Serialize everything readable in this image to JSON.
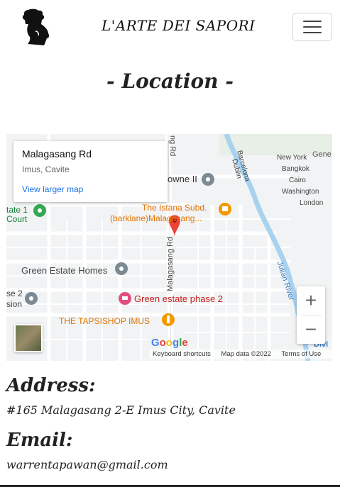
{
  "navbar": {
    "brand": "L'ARTE DEI SAPORI",
    "logo_icon": "chef-head-logo-icon",
    "menu_icon": "hamburger-menu-icon"
  },
  "section": {
    "title": "- Location -"
  },
  "map": {
    "info": {
      "place": "Malagasang Rd",
      "area": "Imus, Cavite",
      "link": "View larger map"
    },
    "labels": {
      "road_main": "Malagasang Rd",
      "road_top": "ng Rd",
      "towne": "owne II",
      "istana_line1": "The Istana Subd.",
      "istana_line2": "(barklane)Malagasang...",
      "estate_court_1": "tate 1",
      "estate_court_2": "Court",
      "green_estate_homes": "Green Estate Homes",
      "green_estate_phase2": "Green estate phase 2",
      "phase2_left_1": "se 2",
      "phase2_left_2": "sion",
      "tapsishop": "THE TAPSISHOP IMUS",
      "barcelona": "Barcelona",
      "dublin": "Dublin",
      "new_york": "New York",
      "gene": "Gene",
      "bangkok": "Bangkok",
      "cairo": "Cairo",
      "washington": "Washington",
      "london": "London",
      "julian_river": "Julian River",
      "divi": "Divi"
    },
    "zoom_in": "+",
    "zoom_out": "−",
    "google": "Google",
    "attribution": {
      "shortcuts": "Keyboard shortcuts",
      "data": "Map data ©2022",
      "terms": "Terms of Use"
    },
    "colors": {
      "water": "#a8d2f0",
      "pin": "#ea4335",
      "poi_green": "#34a853",
      "poi_orange": "#f29900",
      "poi_pink": "#e04f80",
      "poi_gray": "#7b8a94"
    }
  },
  "address": {
    "title": "Address:",
    "text": "#165 Malagasang 2-E Imus City, Cavite"
  },
  "email": {
    "title": "Email:",
    "text": "warrentapawan@gmail.com"
  }
}
